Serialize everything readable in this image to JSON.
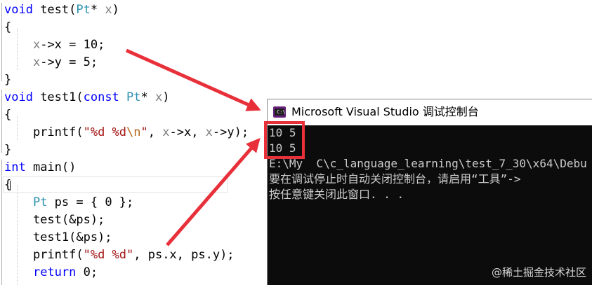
{
  "editor": {
    "lines": [
      {
        "tokens": [
          {
            "c": "kw",
            "t": "void"
          },
          {
            "c": "",
            "t": " test("
          },
          {
            "c": "ty",
            "t": "Pt"
          },
          {
            "c": "",
            "t": "* "
          },
          {
            "c": "pr",
            "t": "x"
          },
          {
            "c": "",
            "t": ")"
          }
        ]
      },
      {
        "tokens": [
          {
            "c": "",
            "t": "{"
          }
        ]
      },
      {
        "tokens": [
          {
            "c": "",
            "t": "    "
          },
          {
            "c": "pr",
            "t": "x"
          },
          {
            "c": "",
            "t": "->x = 10;"
          }
        ]
      },
      {
        "tokens": [
          {
            "c": "",
            "t": "    "
          },
          {
            "c": "pr",
            "t": "x"
          },
          {
            "c": "",
            "t": "->y = 5;"
          }
        ]
      },
      {
        "tokens": [
          {
            "c": "",
            "t": "}"
          }
        ]
      },
      {
        "tokens": [
          {
            "c": "kw",
            "t": "void"
          },
          {
            "c": "",
            "t": " test1("
          },
          {
            "c": "kw",
            "t": "const"
          },
          {
            "c": "",
            "t": " "
          },
          {
            "c": "ty",
            "t": "Pt"
          },
          {
            "c": "",
            "t": "* "
          },
          {
            "c": "pr",
            "t": "x"
          },
          {
            "c": "",
            "t": ")"
          }
        ]
      },
      {
        "tokens": [
          {
            "c": "",
            "t": "{"
          }
        ]
      },
      {
        "tokens": [
          {
            "c": "",
            "t": "    printf("
          },
          {
            "c": "st",
            "t": "\"%d %d"
          },
          {
            "c": "esc",
            "t": "\\n"
          },
          {
            "c": "st",
            "t": "\""
          },
          {
            "c": "",
            "t": ", "
          },
          {
            "c": "pr",
            "t": "x"
          },
          {
            "c": "",
            "t": "->x, "
          },
          {
            "c": "pr",
            "t": "x"
          },
          {
            "c": "",
            "t": "->y);"
          }
        ]
      },
      {
        "tokens": [
          {
            "c": "",
            "t": "}"
          }
        ]
      },
      {
        "tokens": [
          {
            "c": "kw",
            "t": "int"
          },
          {
            "c": "",
            "t": " main()"
          }
        ]
      },
      {
        "tokens": [
          {
            "c": "",
            "t": "{"
          }
        ]
      },
      {
        "tokens": [
          {
            "c": "",
            "t": "    "
          },
          {
            "c": "ty",
            "t": "Pt"
          },
          {
            "c": "",
            "t": " ps = { 0 };"
          }
        ]
      },
      {
        "tokens": [
          {
            "c": "",
            "t": "    test(&ps);"
          }
        ]
      },
      {
        "tokens": [
          {
            "c": "",
            "t": "    test1(&ps);"
          }
        ]
      },
      {
        "tokens": [
          {
            "c": "",
            "t": "    printf("
          },
          {
            "c": "st",
            "t": "\"%d %d\""
          },
          {
            "c": "",
            "t": ", ps.x, ps.y);"
          }
        ]
      },
      {
        "tokens": [
          {
            "c": "",
            "t": "    "
          },
          {
            "c": "kw",
            "t": "return"
          },
          {
            "c": "",
            "t": " 0;"
          }
        ]
      }
    ]
  },
  "console": {
    "icon": "console-app-icon",
    "title": "Microsoft Visual Studio 调试控制台",
    "output": [
      "10 5",
      "10 5",
      "E:\\My  C\\c_language_learning\\test_7_30\\x64\\Debu",
      "要在调试停止时自动关闭控制台，请启用“工具”->",
      "按任意键关闭此窗口. . ."
    ]
  },
  "annotation": {
    "box_color": "#e8303a",
    "arrow_color": "#e8303a"
  },
  "watermark": "@稀土掘金技术社区"
}
